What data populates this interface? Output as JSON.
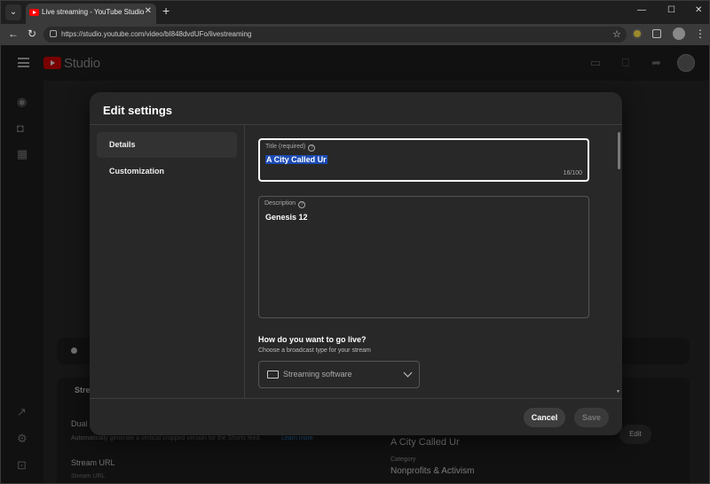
{
  "browser": {
    "tab_title": "Live streaming - YouTube Studio",
    "tab_close": "✕",
    "new_tab": "+",
    "minimize": "—",
    "maximize": "☐",
    "close": "✕",
    "back": "←",
    "reload": "↻",
    "url": "https://studio.youtube.com/video/bI848dvdUFo/livestreaming",
    "star": "☆"
  },
  "studio": {
    "logo_text": "Studio",
    "left_icons": [
      "live-icon",
      "camera-icon",
      "calendar-icon",
      "external-icon",
      "settings-icon",
      "feedback-icon"
    ],
    "background": {
      "stream_tab": "Strea",
      "dual_label": "Dual",
      "dual_desc": "Automatically generate a vertical cropped version for the Shorts feed.",
      "learn_more": "Learn more",
      "stream_url_label": "Stream URL",
      "stream_url_sub": "Stream URL",
      "video_title": "A City Called Ur",
      "category_label": "Category",
      "category_value": "Nonprofits & Activism",
      "edit_button": "Edit"
    }
  },
  "dialog": {
    "title": "Edit settings",
    "sidebar": [
      {
        "label": "Details",
        "active": true
      },
      {
        "label": "Customization",
        "active": false
      }
    ],
    "title_field": {
      "label": "Title (required)",
      "help": "?",
      "value": "A City Called Ur",
      "counter": "16/100"
    },
    "description_field": {
      "label": "Description",
      "help": "?",
      "value": "Genesis 12"
    },
    "go_live": {
      "heading": "How do you want to go live?",
      "subheading": "Choose a broadcast type for your stream",
      "selected": "Streaming software"
    },
    "buttons": {
      "cancel": "Cancel",
      "save": "Save"
    }
  }
}
